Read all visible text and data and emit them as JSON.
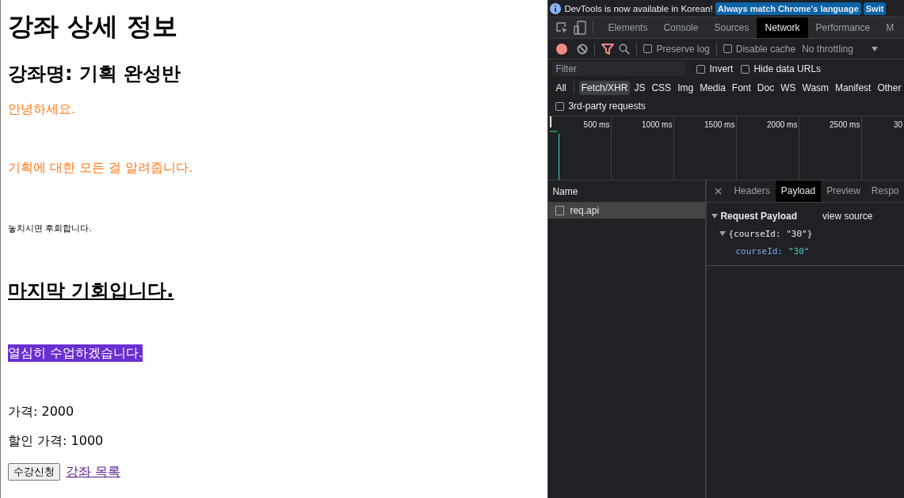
{
  "page": {
    "blocks": [
      {
        "kind": "title",
        "text": "강좌 상세 정보"
      },
      {
        "kind": "subtitle",
        "text": "강좌명: 기획 완성반"
      },
      {
        "kind": "notice",
        "text": "안녕하세요."
      },
      {
        "kind": "notice",
        "text": "기획에 대한 모든 걸 알려줍니다."
      },
      {
        "kind": "small",
        "text": "놓치시면 후회합니다."
      },
      {
        "kind": "underlined",
        "text": "마지막 기회입니다."
      },
      {
        "kind": "highlight",
        "text": "열심히 수업하겠습니다."
      },
      {
        "kind": "price",
        "text": "가격: 2000"
      },
      {
        "kind": "price",
        "text": "할인 가격: 1000"
      }
    ],
    "button": "수강신청",
    "link": "강좌 목록"
  },
  "devtools": {
    "infobar": {
      "message": "DevTools is now available in Korean!",
      "buttons": [
        "Always match Chrome's language",
        "Swit"
      ]
    },
    "tabs": [
      {
        "label": "Elements",
        "selected": false
      },
      {
        "label": "Console",
        "selected": false
      },
      {
        "label": "Sources",
        "selected": false
      },
      {
        "label": "Network",
        "selected": true
      },
      {
        "label": "Performance",
        "selected": false
      },
      {
        "label": "M",
        "selected": false
      }
    ],
    "toolbar": {
      "recording": true,
      "filter_active": true,
      "preserve_log": {
        "label": "Preserve log",
        "checked": false
      },
      "disable_cache": {
        "label": "Disable cache",
        "checked": false
      },
      "throttling": "No throttling"
    },
    "filter": {
      "placeholder": "Filter",
      "invert": {
        "label": "Invert",
        "checked": false
      },
      "hide_data_urls": {
        "label": "Hide data URLs",
        "checked": false
      }
    },
    "types": [
      {
        "label": "All",
        "selected": false
      },
      {
        "label": "Fetch/XHR",
        "selected": true
      },
      {
        "label": "JS",
        "selected": false
      },
      {
        "label": "CSS",
        "selected": false
      },
      {
        "label": "Img",
        "selected": false
      },
      {
        "label": "Media",
        "selected": false
      },
      {
        "label": "Font",
        "selected": false
      },
      {
        "label": "Doc",
        "selected": false
      },
      {
        "label": "WS",
        "selected": false
      },
      {
        "label": "Wasm",
        "selected": false
      },
      {
        "label": "Manifest",
        "selected": false
      },
      {
        "label": "Other",
        "selected": false
      }
    ],
    "third_party": {
      "label": "3rd-party requests",
      "checked": false
    },
    "timeline": {
      "ticks": [
        "500 ms",
        "1000 ms",
        "1500 ms",
        "2000 ms",
        "2500 ms",
        "30"
      ]
    },
    "requests": {
      "column": "Name",
      "rows": [
        {
          "name": "req.api",
          "selected": true
        }
      ]
    },
    "detail": {
      "tabs": [
        {
          "label": "Headers",
          "selected": false
        },
        {
          "label": "Payload",
          "selected": true
        },
        {
          "label": "Preview",
          "selected": false
        },
        {
          "label": "Respo",
          "selected": false
        }
      ],
      "section": {
        "title": "Request Payload",
        "link": "view source",
        "expanded": true,
        "object": {
          "summary": "{courseId: \"30\"}",
          "expanded": true,
          "properties": [
            {
              "key": "courseId:",
              "value": "\"30\""
            }
          ]
        }
      }
    }
  }
}
